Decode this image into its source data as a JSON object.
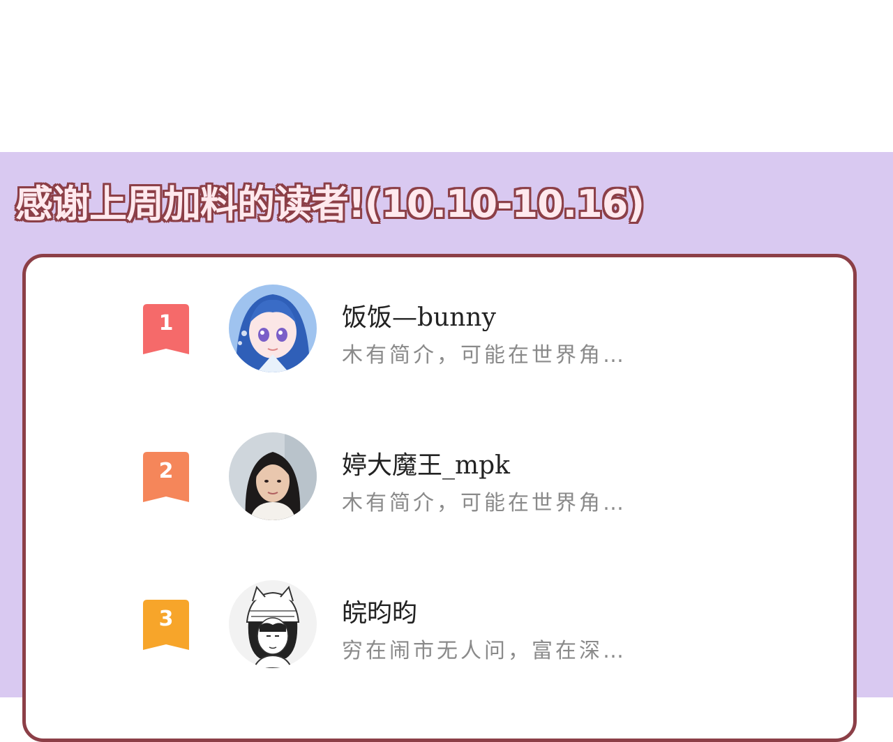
{
  "banner": {
    "title": "感谢上周加料的读者!(10.10-10.16)"
  },
  "colors": {
    "background_purple": "#d9c9f1",
    "card_border": "#8c3f47",
    "rank1": "#f56a6a",
    "rank2": "#f5865a",
    "rank3": "#f7a52a",
    "bio_text": "#8a8a8a"
  },
  "readers": [
    {
      "rank": "1",
      "name": "饭饭—bunny",
      "bio": "木有简介，可能在世界角…",
      "avatar": "anime-girl-avatar"
    },
    {
      "rank": "2",
      "name": "婷大魔王_mpk",
      "bio": "木有简介，可能在世界角…",
      "avatar": "woman-photo-avatar"
    },
    {
      "rank": "3",
      "name": "皖昀昀",
      "bio": "穷在闹市无人问，富在深…",
      "avatar": "sketch-character-avatar"
    }
  ]
}
